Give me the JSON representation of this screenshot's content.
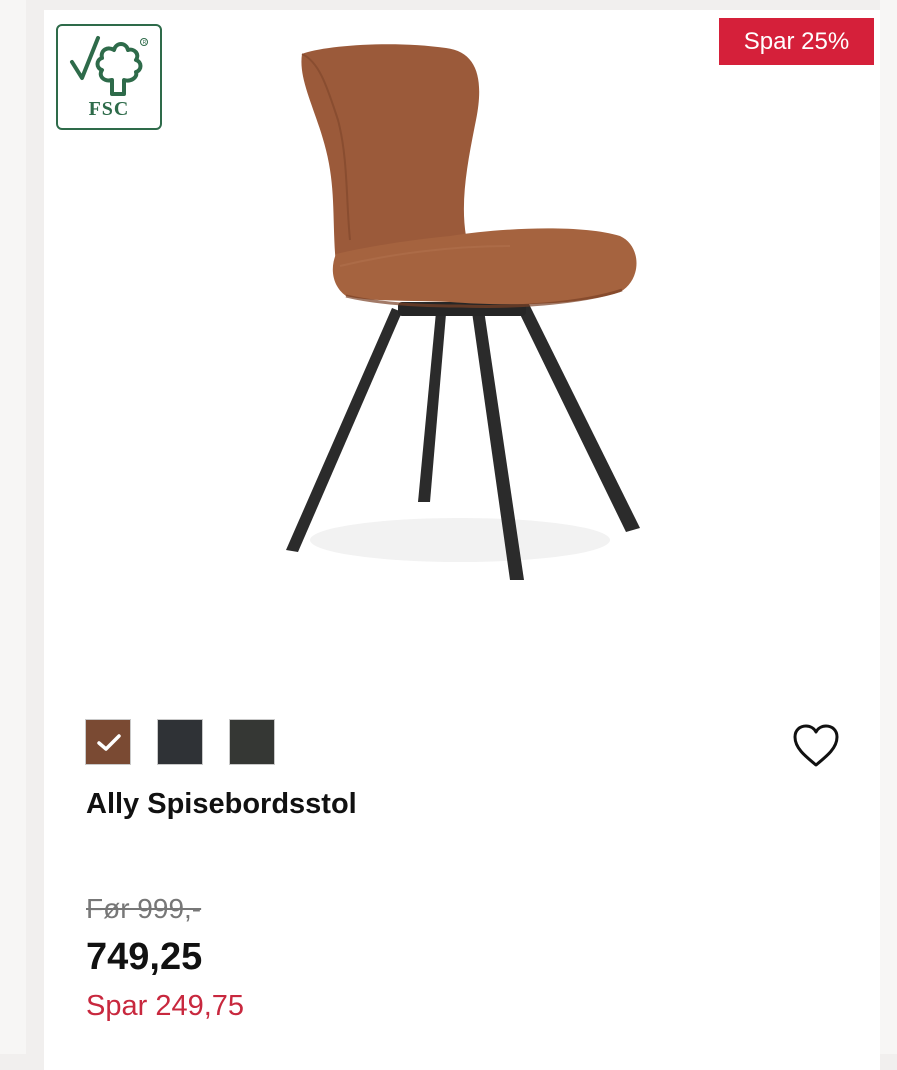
{
  "badges": {
    "certification": "FSC",
    "discount": "Spar 25%"
  },
  "product": {
    "image_alt": "brown upholstered dining chair with black legs",
    "title": "Ally Spisebordsstol",
    "old_price": "Før 999,-",
    "price": "749,25",
    "savings": "Spar 249,75"
  },
  "swatches": [
    {
      "color": "#7a4a33",
      "selected": true
    },
    {
      "color": "#2f3236",
      "selected": false
    },
    {
      "color": "#353734",
      "selected": false
    }
  ],
  "colors": {
    "sale_badge": "#d5203a",
    "savings_text": "#c8283e",
    "fsc_green": "#2e6b4a",
    "seat_leather": "#9b5a3a"
  },
  "icons": {
    "favorite": "heart-icon",
    "certification": "fsc-tree-icon",
    "selected": "checkmark-icon"
  }
}
